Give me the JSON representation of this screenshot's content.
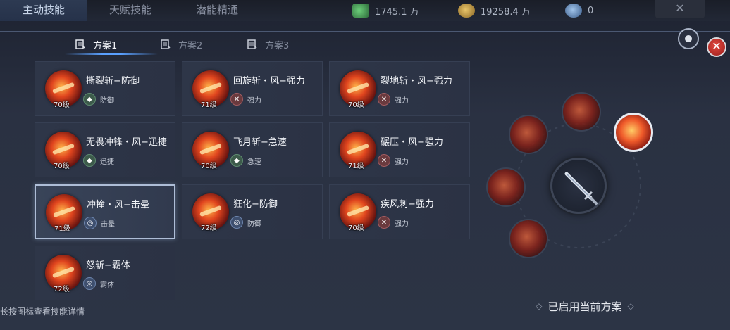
{
  "top_tabs": [
    {
      "label": "主动技能",
      "active": true
    },
    {
      "label": "天赋技能",
      "active": false
    },
    {
      "label": "潜能精通",
      "active": false
    }
  ],
  "resources": [
    {
      "icon": "green-gem-icon",
      "value": "1745.1 万"
    },
    {
      "icon": "gold-coin-icon",
      "value": "19258.4 万"
    },
    {
      "icon": "blue-crystal-icon",
      "value": "0"
    }
  ],
  "top_close_glyph": "✕",
  "close_glyph": "✕",
  "plan_tabs": [
    {
      "label": "方案1",
      "active": true
    },
    {
      "label": "方案2",
      "active": false
    },
    {
      "label": "方案3",
      "active": false
    }
  ],
  "skills": [
    {
      "name": "撕裂斩−防御",
      "level": "70级",
      "attr": "防御",
      "attr_type": "def"
    },
    {
      "name": "回旋斩・风−强力",
      "level": "71级",
      "attr": "强力",
      "attr_type": "str"
    },
    {
      "name": "裂地斩・风−强力",
      "level": "70级",
      "attr": "强力",
      "attr_type": "str"
    },
    {
      "name": "无畏冲锋・风−迅捷",
      "level": "70级",
      "attr": "迅捷",
      "attr_type": "spd"
    },
    {
      "name": "飞月斩−急速",
      "level": "70级",
      "attr": "急速",
      "attr_type": "def"
    },
    {
      "name": "碾压・风−强力",
      "level": "71级",
      "attr": "强力",
      "attr_type": "str"
    },
    {
      "name": "冲撞・风−击晕",
      "level": "71级",
      "attr": "击晕",
      "attr_type": "stn"
    },
    {
      "name": "狂化−防御",
      "level": "72级",
      "attr": "防御",
      "attr_type": "sup"
    },
    {
      "name": "疾风刺−强力",
      "level": "70级",
      "attr": "强力",
      "attr_type": "str"
    },
    {
      "name": "怒斩−霸体",
      "level": "72级",
      "attr": "霸体",
      "attr_type": "sup"
    }
  ],
  "hint": "长按图标查看技能详情",
  "status_text": "已启用当前方案",
  "ornament": "◇"
}
